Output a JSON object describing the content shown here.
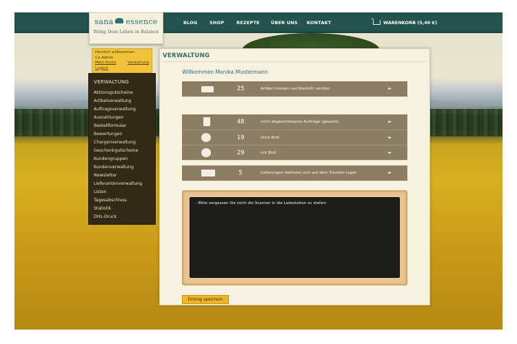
{
  "brand": {
    "name_left": "sana",
    "name_right": "essence",
    "tagline": "Bring Dein Leben in Balance"
  },
  "nav": {
    "items": [
      "BLOG",
      "SHOP",
      "REZEPTE",
      "ÜBER UNS",
      "KONTAKT"
    ],
    "cart_label": "WARENKORB (5,40 €)"
  },
  "welcome": {
    "greeting": "Herzlich willkommen",
    "user": "Ca Admin",
    "account_link": "Mein Konto",
    "admin_link": "Verwaltung",
    "logout_link": "Logout"
  },
  "sidebar": {
    "heading": "VERWALTUNG",
    "items": [
      "Aktionsgutscheine",
      "Artikelverwaltung",
      "Auftragsverwaltung",
      "Auszahlungen",
      "Bestellformular",
      "Bewertungen",
      "Chargenverwaltung",
      "Geschenkgutscheine",
      "Kundengruppen",
      "Kundenverwaltung",
      "Newsletter",
      "Lieferantenverwaltung",
      "Listen",
      "Tagesabschluss",
      "Statistik",
      "DHL-Druck"
    ]
  },
  "main": {
    "title": "VERWALTUNG",
    "greeting": "Willkommen Monika Mustermann",
    "stats": [
      {
        "icon": "truck-icon",
        "count": "25",
        "text": "Artikel müssen nachbestellt werden",
        "arrow": "►"
      },
      {
        "icon": "document-icon",
        "count": "48",
        "text": "nicht abgeschlossene Aufträge (gesamt)",
        "arrow": "►"
      },
      {
        "icon": "no-bread-icon",
        "count": "19",
        "text": "ohne Brot",
        "arrow": "►"
      },
      {
        "icon": "bread-icon",
        "count": "29",
        "text": "mit Brot",
        "arrow": "►"
      },
      {
        "icon": "forklift-icon",
        "count": "5",
        "text": "Lieferungen befinden sich auf dem Transfer-Lager",
        "arrow": "►"
      }
    ],
    "note": "- Bitte vergessen Sie nicht die Scanner in die Ladestation zu stellen",
    "save_button": "Eintrag speichern"
  },
  "colors": {
    "topbar": "#24524d",
    "accent_yellow": "#f2b526",
    "strip": "#8c7d64",
    "title_teal": "#2d6c6b"
  }
}
